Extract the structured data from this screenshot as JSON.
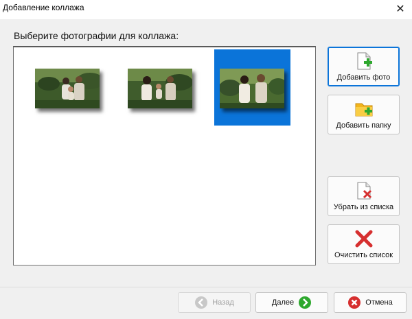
{
  "window": {
    "title": "Добавление коллажа",
    "close_glyph": "✕"
  },
  "main": {
    "prompt": "Выберите фотографии для коллажа:",
    "photos": [
      {
        "name": "photo-1",
        "selected": false
      },
      {
        "name": "photo-2",
        "selected": false
      },
      {
        "name": "photo-3",
        "selected": true
      }
    ],
    "selection_color": "#0b74d9"
  },
  "side_buttons": {
    "add_photo": {
      "label": "Добавить фото",
      "icon": "add-file-icon"
    },
    "add_folder": {
      "label": "Добавить папку",
      "icon": "add-folder-icon"
    },
    "remove": {
      "label": "Убрать из списка",
      "icon": "remove-file-icon"
    },
    "clear": {
      "label": "Очистить список",
      "icon": "clear-icon"
    }
  },
  "footer": {
    "back": {
      "label": "Назад",
      "icon": "back-arrow-icon",
      "enabled": false
    },
    "next": {
      "label": "Далее",
      "icon": "next-arrow-icon",
      "enabled": true
    },
    "cancel": {
      "label": "Отмена",
      "icon": "cancel-icon",
      "enabled": true
    }
  },
  "colors": {
    "accent": "#0b74d9",
    "green": "#2ea82e",
    "red": "#d62f2f"
  }
}
